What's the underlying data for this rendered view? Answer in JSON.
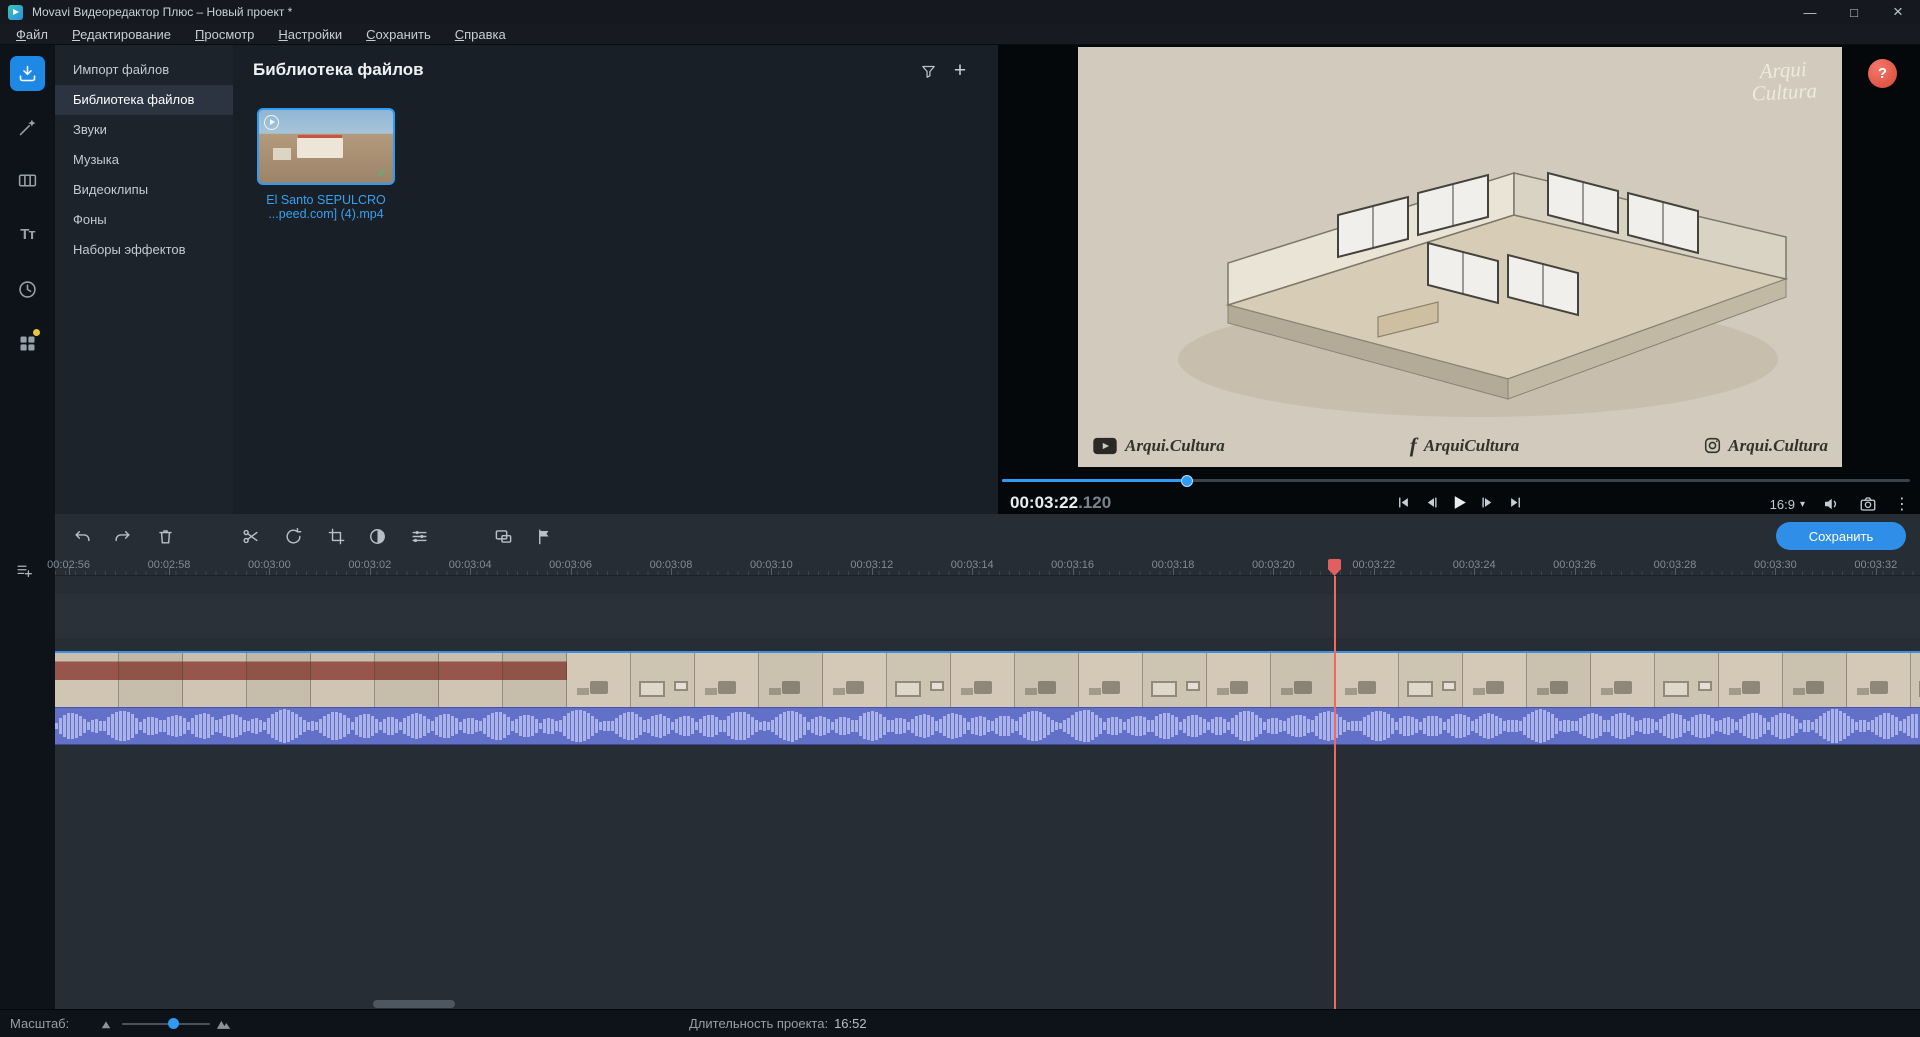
{
  "window": {
    "title": "Movavi Видеоредактор Плюс – Новый проект *"
  },
  "menu": {
    "items": [
      "Файл",
      "Редактирование",
      "Просмотр",
      "Настройки",
      "Сохранить",
      "Справка"
    ]
  },
  "sidebar": {
    "items": [
      {
        "label": "Импорт файлов",
        "selected": false
      },
      {
        "label": "Библиотека файлов",
        "selected": true
      },
      {
        "label": "Звуки",
        "selected": false
      },
      {
        "label": "Музыка",
        "selected": false
      },
      {
        "label": "Видеоклипы",
        "selected": false
      },
      {
        "label": "Фоны",
        "selected": false
      },
      {
        "label": "Наборы эффектов",
        "selected": false
      }
    ]
  },
  "library": {
    "title": "Библиотека файлов",
    "clip_name_line1": "El Santo SEPULCRO",
    "clip_name_line2": "...peed.com] (4).mp4",
    "clip_check": "✓"
  },
  "preview": {
    "timecode": "00:03:22",
    "timecode_ms": ".120",
    "aspect_ratio": "16:9",
    "progress_fraction": 0.204,
    "help_glyph": "?",
    "watermark_top_line1": "Arqui",
    "watermark_top_line2": "Cultura",
    "watermark_youtube": "Arqui.Cultura",
    "watermark_facebook": "ArquiCultura",
    "watermark_facebook_glyph": "f",
    "watermark_instagram": "Arqui.Cultura"
  },
  "toolbar": {
    "save_label": "Сохранить"
  },
  "timeline": {
    "ruler_labels": [
      "00:02:56",
      "00:02:58",
      "00:03:00",
      "00:03:02",
      "00:03:04",
      "00:03:06",
      "00:03:08",
      "00:03:10",
      "00:03:12",
      "00:03:14",
      "00:03:16",
      "00:03:18",
      "00:03:20",
      "00:03:22",
      "00:03:24",
      "00:03:26",
      "00:03:28",
      "00:03:30",
      "00:03:32"
    ]
  },
  "statusbar": {
    "zoom_label": "Масштаб:",
    "duration_label": "Длительность проекта:",
    "duration_value": "16:52"
  },
  "icons": {
    "titles_section_glyph": "Тт",
    "title_track_glyph": "T",
    "audio_track_glyph": "♪",
    "kebab": "⋮",
    "chevron_down": "▾",
    "plus": "+",
    "minimize": "—",
    "maximize": "□",
    "close": "×"
  },
  "colors": {
    "accent": "#2e9bf5",
    "playhead": "#ee6a60",
    "waveform_bg": "#6370c8",
    "waveform_bar": "#a9b3ea",
    "save_button": "#2f8fe8"
  }
}
